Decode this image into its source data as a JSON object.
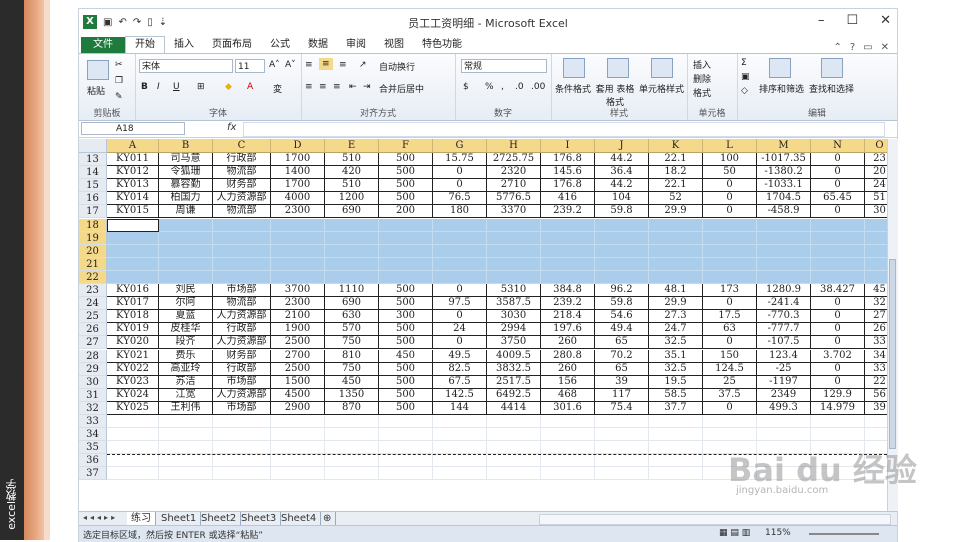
{
  "side_caption": "excel教学",
  "watermark": {
    "brand": "Bai du 经验",
    "url": "jingyan.baidu.com"
  },
  "window": {
    "title": "员工工资明细 - Microsoft Excel",
    "qat": [
      "X",
      "▣",
      "↶",
      "↷",
      "▯",
      "⇣"
    ],
    "controls": [
      "–",
      "☐",
      "✕"
    ]
  },
  "tabs": [
    "文件",
    "开始",
    "插入",
    "页面布局",
    "公式",
    "数据",
    "审阅",
    "视图",
    "特色功能"
  ],
  "active_tab": "开始",
  "ribbon": {
    "clipboard": {
      "label": "剪贴板",
      "paste": "粘贴"
    },
    "font": {
      "label": "字体",
      "name": "宋体",
      "size": "11",
      "bold": "B",
      "italic": "I",
      "underline": "U"
    },
    "alignment": {
      "label": "对齐方式",
      "wrap": "自动换行",
      "merge": "合并后居中"
    },
    "number": {
      "label": "数字",
      "format": "常规",
      "percent": "%",
      "comma": ","
    },
    "styles": {
      "label": "样式",
      "conditional": "条件格式",
      "table": "套用 表格格式",
      "cell": "单元格样式"
    },
    "cells": {
      "label": "单元格",
      "insert": "插入",
      "delete": "删除",
      "format": "格式"
    },
    "editing": {
      "label": "编辑",
      "sort": "排序和筛选",
      "find": "查找和选择"
    }
  },
  "formula_bar": {
    "name_box": "A18",
    "fx": "fx",
    "value": ""
  },
  "columns": [
    "A",
    "B",
    "C",
    "D",
    "E",
    "F",
    "G",
    "H",
    "I",
    "J",
    "K",
    "L",
    "M",
    "N",
    "O"
  ],
  "rows": [
    {
      "n": "13",
      "cells": [
        "KY011",
        "司马意",
        "行政部",
        "1700",
        "510",
        "500",
        "15.75",
        "2725.75",
        "176.8",
        "44.2",
        "22.1",
        "100",
        "-1017.35",
        "0",
        "23"
      ]
    },
    {
      "n": "14",
      "cells": [
        "KY012",
        "令狐珊",
        "物流部",
        "1400",
        "420",
        "500",
        "0",
        "2320",
        "145.6",
        "36.4",
        "18.2",
        "50",
        "-1380.2",
        "0",
        "20"
      ]
    },
    {
      "n": "15",
      "cells": [
        "KY013",
        "慕容勤",
        "财务部",
        "1700",
        "510",
        "500",
        "0",
        "2710",
        "176.8",
        "44.2",
        "22.1",
        "0",
        "-1033.1",
        "0",
        "24"
      ]
    },
    {
      "n": "16",
      "cells": [
        "KY014",
        "柏国力",
        "人力资源部",
        "4000",
        "1200",
        "500",
        "76.5",
        "5776.5",
        "416",
        "104",
        "52",
        "0",
        "1704.5",
        "65.45",
        "51"
      ]
    },
    {
      "n": "17",
      "cells": [
        "KY015",
        "周谦",
        "物流部",
        "2300",
        "690",
        "200",
        "180",
        "3370",
        "239.2",
        "59.8",
        "29.9",
        "0",
        "-458.9",
        "0",
        "30"
      ]
    },
    {
      "n": "18",
      "sel": true,
      "cells": []
    },
    {
      "n": "19",
      "sel": true,
      "cells": []
    },
    {
      "n": "20",
      "sel": true,
      "cells": []
    },
    {
      "n": "21",
      "sel": true,
      "cells": []
    },
    {
      "n": "22",
      "sel": true,
      "cells": []
    },
    {
      "n": "23",
      "cells": [
        "KY016",
        "刘民",
        "市场部",
        "3700",
        "1110",
        "500",
        "0",
        "5310",
        "384.8",
        "96.2",
        "48.1",
        "173",
        "1280.9",
        "38.427",
        "45"
      ]
    },
    {
      "n": "24",
      "cells": [
        "KY017",
        "尔阿",
        "物流部",
        "2300",
        "690",
        "500",
        "97.5",
        "3587.5",
        "239.2",
        "59.8",
        "29.9",
        "0",
        "-241.4",
        "0",
        "32"
      ]
    },
    {
      "n": "25",
      "cells": [
        "KY018",
        "夏蓝",
        "人力资源部",
        "2100",
        "630",
        "300",
        "0",
        "3030",
        "218.4",
        "54.6",
        "27.3",
        "17.5",
        "-770.3",
        "0",
        "27"
      ]
    },
    {
      "n": "26",
      "cells": [
        "KY019",
        "皮桂华",
        "行政部",
        "1900",
        "570",
        "500",
        "24",
        "2994",
        "197.6",
        "49.4",
        "24.7",
        "63",
        "-777.7",
        "0",
        "26"
      ]
    },
    {
      "n": "27",
      "cells": [
        "KY020",
        "段齐",
        "人力资源部",
        "2500",
        "750",
        "500",
        "0",
        "3750",
        "260",
        "65",
        "32.5",
        "0",
        "-107.5",
        "0",
        "33"
      ]
    },
    {
      "n": "28",
      "cells": [
        "KY021",
        "费乐",
        "财务部",
        "2700",
        "810",
        "450",
        "49.5",
        "4009.5",
        "280.8",
        "70.2",
        "35.1",
        "150",
        "123.4",
        "3.702",
        "34"
      ]
    },
    {
      "n": "29",
      "cells": [
        "KY022",
        "高亚玲",
        "行政部",
        "2500",
        "750",
        "500",
        "82.5",
        "3832.5",
        "260",
        "65",
        "32.5",
        "124.5",
        "-25",
        "0",
        "33"
      ]
    },
    {
      "n": "30",
      "cells": [
        "KY023",
        "苏洁",
        "市场部",
        "1500",
        "450",
        "500",
        "67.5",
        "2517.5",
        "156",
        "39",
        "19.5",
        "25",
        "-1197",
        "0",
        "22"
      ]
    },
    {
      "n": "31",
      "cells": [
        "KY024",
        "江宽",
        "人力资源部",
        "4500",
        "1350",
        "500",
        "142.5",
        "6492.5",
        "468",
        "117",
        "58.5",
        "37.5",
        "2349",
        "129.9",
        "56"
      ]
    },
    {
      "n": "32",
      "cells": [
        "KY025",
        "王利伟",
        "市场部",
        "2900",
        "870",
        "500",
        "144",
        "4414",
        "301.6",
        "75.4",
        "37.7",
        "0",
        "499.3",
        "14.979",
        "39"
      ]
    },
    {
      "n": "33",
      "cells": []
    },
    {
      "n": "34",
      "cells": []
    },
    {
      "n": "35",
      "cells": []
    },
    {
      "n": "36",
      "cells": []
    },
    {
      "n": "37",
      "cells": []
    }
  ],
  "sheets": [
    "练习",
    "Sheet1",
    "Sheet2",
    "Sheet3",
    "Sheet4"
  ],
  "active_sheet": "练习",
  "status": {
    "message": "选定目标区域，然后按 ENTER 或选择“粘贴”",
    "zoom": "115%"
  }
}
